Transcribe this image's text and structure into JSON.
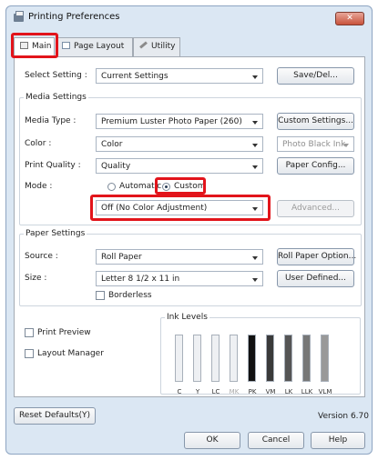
{
  "window": {
    "title": "Printing Preferences",
    "close_glyph": "✕"
  },
  "tabs": [
    {
      "label": "Main",
      "icon": "printer-icon"
    },
    {
      "label": "Page Layout",
      "icon": "page-icon"
    },
    {
      "label": "Utility",
      "icon": "wrench-icon"
    }
  ],
  "select_setting": {
    "label": "Select Setting :",
    "value": "Current Settings",
    "save_button": "Save/Del..."
  },
  "media_settings": {
    "title": "Media Settings",
    "media_type": {
      "label": "Media Type :",
      "value": "Premium Luster Photo Paper (260)",
      "button": "Custom Settings..."
    },
    "color": {
      "label": "Color :",
      "value": "Color",
      "ink_value": "Photo Black Ink"
    },
    "print_quality": {
      "label": "Print Quality :",
      "value": "Quality",
      "button": "Paper Config..."
    },
    "mode": {
      "label": "Mode :",
      "automatic": "Automatic",
      "custom": "Custom",
      "selected": "custom",
      "custom_value": "Off (No Color Adjustment)",
      "advanced_button": "Advanced..."
    }
  },
  "paper_settings": {
    "title": "Paper Settings",
    "source": {
      "label": "Source :",
      "value": "Roll Paper",
      "button": "Roll Paper Option..."
    },
    "size": {
      "label": "Size :",
      "value": "Letter 8 1/2 x 11 in",
      "button": "User Defined..."
    },
    "borderless": "Borderless"
  },
  "print_preview": "Print Preview",
  "layout_manager": "Layout Manager",
  "ink_levels": {
    "title": "Ink Levels",
    "inks": [
      {
        "code": "C",
        "level": 0,
        "color": "#00a0e0",
        "active": true
      },
      {
        "code": "Y",
        "level": 0,
        "color": "#f5e400",
        "active": true
      },
      {
        "code": "LC",
        "level": 0,
        "color": "#7fd0f0",
        "active": true
      },
      {
        "code": "MK",
        "level": 0,
        "color": "#333333",
        "active": false
      },
      {
        "code": "PK",
        "level": 1.0,
        "color": "#111111",
        "active": true
      },
      {
        "code": "VM",
        "level": 1.0,
        "color": "#3a3a3a",
        "active": true
      },
      {
        "code": "LK",
        "level": 1.0,
        "color": "#555555",
        "active": true
      },
      {
        "code": "LLK",
        "level": 1.0,
        "color": "#777777",
        "active": true
      },
      {
        "code": "VLM",
        "level": 1.0,
        "color": "#999999",
        "active": true
      }
    ]
  },
  "reset_button": "Reset Defaults(Y)",
  "version": "Version 6.70",
  "footer": {
    "ok": "OK",
    "cancel": "Cancel",
    "help": "Help"
  }
}
